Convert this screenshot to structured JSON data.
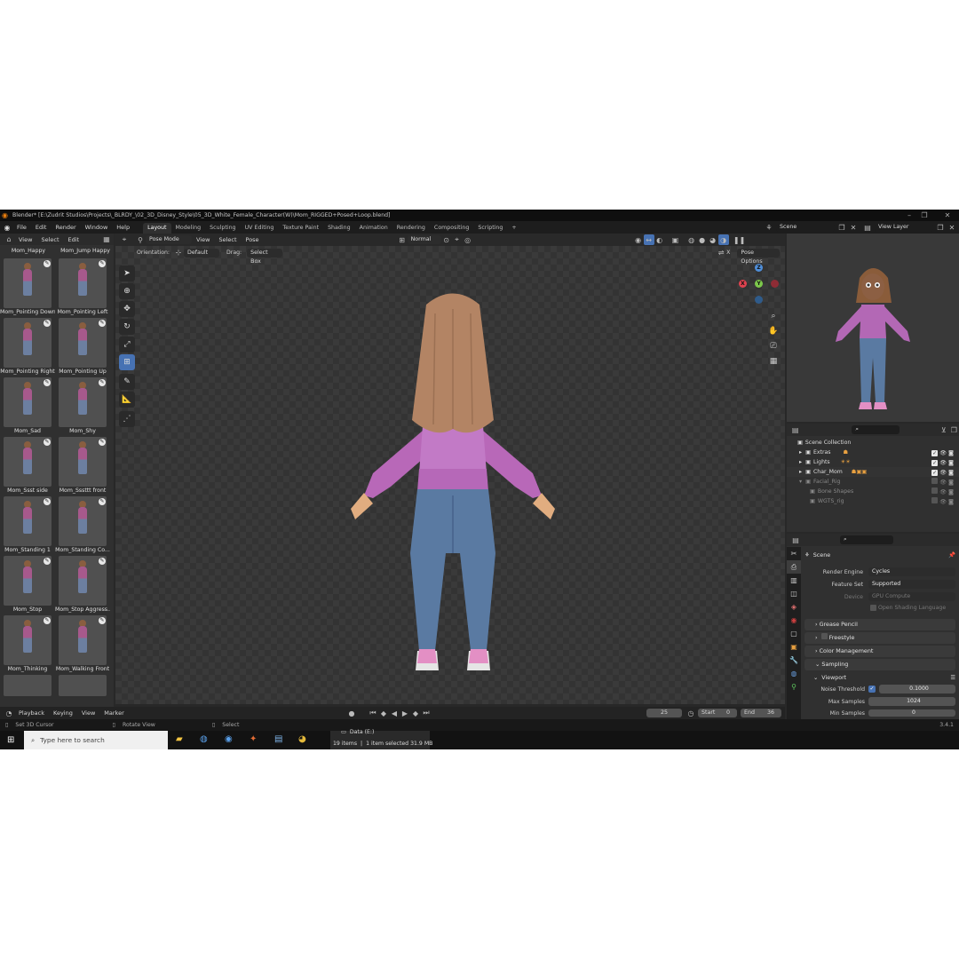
{
  "window": {
    "title": "Blender* [E:\\Zudrit Studios\\Projects\\_BLRDY_\\02_3D_Disney_Style\\05_3D_White_Female_Character(W)\\Mom_RIGGED+Posed+Loop.blend]"
  },
  "menu": [
    "File",
    "Edit",
    "Render",
    "Window",
    "Help"
  ],
  "workspace_tabs": [
    "Layout",
    "Modeling",
    "Sculpting",
    "UV Editing",
    "Texture Paint",
    "Shading",
    "Animation",
    "Rendering",
    "Compositing",
    "Scripting"
  ],
  "active_tab": "Layout",
  "scene_field": "Scene",
  "view_layer_field": "View Layer",
  "asset_browser": {
    "menu": [
      "View",
      "Select",
      "Edit"
    ],
    "top_labels": [
      "Mom_Happy",
      "Mom_Jump Happy"
    ],
    "items": [
      "Mom_Pointing Down",
      "Mom_Pointing Left",
      "Mom_Pointing Right",
      "Mom_Pointing Up",
      "Mom_Sad",
      "Mom_Shy",
      "Mom_Ssst side",
      "Mom_Sssttt front",
      "Mom_Standing 1",
      "Mom_Standing Co...",
      "Mom_Stop",
      "Mom_Stop Aggress...",
      "Mom_Thinking",
      "Mom_Walking Front"
    ]
  },
  "viewport": {
    "mode": "Pose Mode",
    "menu": [
      "View",
      "Select",
      "Pose"
    ],
    "transform": "Normal",
    "orientation_label": "Orientation:",
    "orientation_value": "Default",
    "drag_label": "Drag:",
    "drag_value": "Select Box",
    "pose_options": "Pose Options",
    "x_label": "X"
  },
  "gizmo": {
    "x": "X",
    "y": "Y",
    "z": "Z"
  },
  "timeline": {
    "menu": [
      "Playback",
      "Keying",
      "View",
      "Marker"
    ],
    "current_frame": "25",
    "start_label": "Start",
    "start": "0",
    "end_label": "End",
    "end": "36"
  },
  "status": {
    "left": "Set 3D Cursor",
    "middle": "Rotate View",
    "right": "Select",
    "version": "3.4.1"
  },
  "taskbar": {
    "search_placeholder": "Type here to search",
    "data_drive": "Data (E:)",
    "items_count": "19 items",
    "selection": "1 item selected  31.9 MB"
  },
  "outliner": {
    "root": "Scene Collection",
    "rows": [
      "Extras",
      "Lights",
      "Char_Mom",
      "Facial_Rig",
      "Bone Shapes",
      "WGTS_rig"
    ]
  },
  "properties": {
    "context": "Scene",
    "render_engine_label": "Render Engine",
    "render_engine": "Cycles",
    "feature_set_label": "Feature Set",
    "feature_set": "Supported",
    "device_label": "Device",
    "device": "GPU Compute",
    "osl_label": "Open Shading Language",
    "sections": [
      "Grease Pencil",
      "Freestyle",
      "Color Management",
      "Sampling"
    ],
    "viewport_sub": "Viewport",
    "noise_threshold_label": "Noise Threshold",
    "noise_threshold": "0.1000",
    "max_samples_label": "Max Samples",
    "max_samples": "1024",
    "min_samples_label": "Min Samples",
    "min_samples": "0"
  }
}
